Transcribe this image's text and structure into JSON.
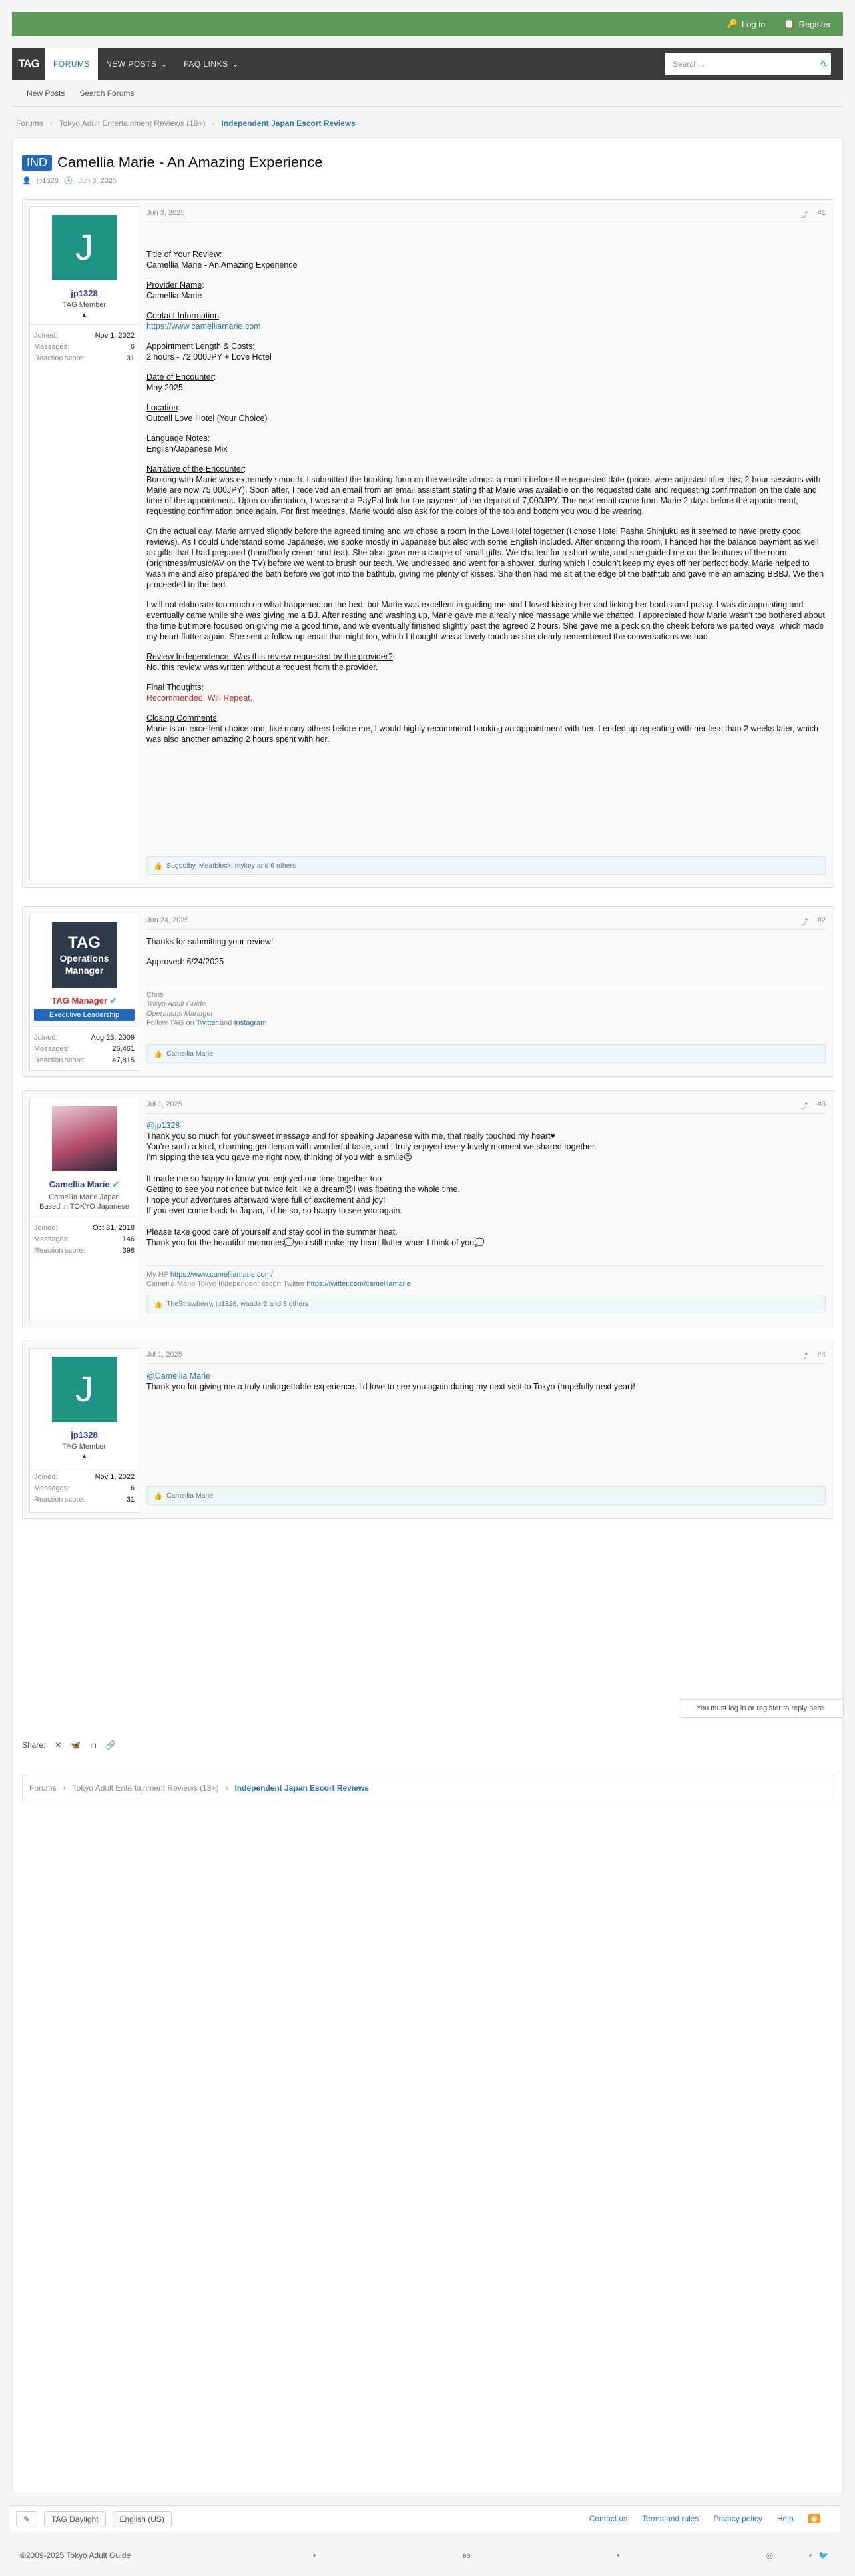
{
  "colors": {
    "accent": "#5d9a57",
    "nav": "#3b3b3b",
    "link": "#2577b1",
    "badge": "#2567b8",
    "username": "#2b3e9e"
  },
  "topbar": {
    "login": "Log in",
    "register": "Register"
  },
  "nav": {
    "logo": "TAG",
    "forums": "FORUMS",
    "new_posts": "NEW POSTS",
    "faq_links": "FAQ LINKS",
    "search_placeholder": "Search..."
  },
  "subnav": {
    "new_posts": "New Posts",
    "search_forums": "Search Forums"
  },
  "breadcrumb": {
    "forums": "Forums",
    "reviews": "Tokyo Adult Entertainment Reviews (18+)",
    "current": "Independent Japan Escort Reviews"
  },
  "thread": {
    "prefix": "IND",
    "title": "Camellia Marie - An Amazing Experience",
    "author": "jp1328",
    "date": "Jun 3, 2025"
  },
  "posts": [
    {
      "user": {
        "avatar_letter": "J",
        "name": "jp1328",
        "title": "TAG Member",
        "joined": "Nov 1, 2022",
        "messages": "6",
        "reaction": "31"
      },
      "date": "Jun 3, 2025",
      "num": "#1",
      "fields": [
        {
          "label": "Title of Your Review",
          "value": "Camellia Marie - An Amazing Experience"
        },
        {
          "label": "Provider Name",
          "value": "Camellia Marie"
        },
        {
          "label": "Contact Information",
          "value": "https://www.camelliamarie.com"
        },
        {
          "label": "Appointment Length & Costs",
          "value": "2 hours - 72,000JPY + Love Hotel"
        },
        {
          "label": "Date of Encounter",
          "value": "May 2025"
        },
        {
          "label": "Location",
          "value": "Outcall Love Hotel (Your Choice)"
        },
        {
          "label": "Language Notes",
          "value": "English/Japanese Mix"
        }
      ],
      "narrative_label": "Narrative of the Encounter",
      "narrative": [
        "Booking with Marie was extremely smooth. I submitted the booking form on the website almost a month before the requested date (prices were adjusted after this; 2-hour sessions with Marie are now 75,000JPY). Soon after, I received an email from an email assistant stating that Marie was available on the requested date and requesting confirmation on the date and time of the appointment. Upon confirmation, I was sent a PayPal link for the payment of the deposit of 7,000JPY. The next email came from Marie 2 days before the appointment, requesting confirmation once again. For first meetings, Marie would also ask for the colors of the top and bottom you would be wearing.",
        "On the actual day, Marie arrived slightly before the agreed timing and we chose a room in the Love Hotel together (I chose Hotel Pasha Shinjuku as it seemed to have pretty good reviews). As I could understand some Japanese, we spoke mostly in Japanese but also with some English included. After entering the room, I handed her the balance payment as well as gifts that I had prepared (hand/body cream and tea). She also gave me a couple of small gifts. We chatted for a short while, and she guided me on the features of the room (brightness/music/AV on the TV) before we went to brush our teeth. We undressed and went for a shower, during which I couldn't keep my eyes off her perfect body. Marie helped to wash me and also prepared the bath before we got into the bathtub, giving me plenty of kisses. She then had me sit at the edge of the bathtub and gave me an amazing BBBJ. We then proceeded to the bed.",
        "I will not elaborate too much on what happened on the bed, but Marie was excellent in guiding me and I loved kissing her and licking her boobs and pussy. I was disappointing and eventually came while she was giving me a BJ. After resting and washing up, Marie gave me a really nice massage while we chatted. I appreciated how Marie wasn't too bothered about the time but more focused on giving me a good time, and we eventually finished slightly past the agreed 2 hours. She gave me a peck on the cheek before we parted ways, which made my heart flutter again. She sent a follow-up email that night too, which I thought was a lovely touch as she clearly remembered the conversations we had."
      ],
      "independence_label": "Review Independence: Was this review requested by the provider?",
      "independence": "No, this review was written without a request from the provider.",
      "final_label": "Final Thoughts",
      "final": "Recommended, Will Repeat.",
      "closing_label": "Closing Comments",
      "closing": "Marie is an excellent choice and, like many others before me, I would highly recommend booking an appointment with her. I ended up repeating with her less than 2 weeks later, which was also another amazing 2 hours spent with her.",
      "reactions": "Sugodiby, Meatblock, mykey and 6 others"
    },
    {
      "user": {
        "avatar_line1": "TAG",
        "avatar_line2": "Operations",
        "avatar_line3": "Manager",
        "name": "TAG Manager",
        "banner": "Executive Leadership",
        "joined": "Aug 23, 2009",
        "messages": "26,461",
        "reaction": "47,815"
      },
      "date": "Jun 24, 2025",
      "num": "#2",
      "text1": "Thanks for submitting your review!",
      "text2": "Approved: 6/24/2025",
      "sig": {
        "name": "Chris",
        "org": "Tokyo Adult Guide",
        "role": "Operations Manager",
        "follow": "Follow TAG on",
        "twitter": "Twitter",
        "and": "and",
        "instagram": "Instagram"
      },
      "reactions": "Camellia Marie"
    },
    {
      "user": {
        "name": "Camellia Marie",
        "title": "Camellia Marie Japan Based in TOKYO Japanese",
        "joined": "Oct 31, 2018",
        "messages": "146",
        "reaction": "398"
      },
      "date": "Jul 1, 2025",
      "num": "#3",
      "mention": "@jp1328",
      "lines": [
        "Thank you so much for your sweet message  and for speaking Japanese with me, that really touched my heart♥",
        "You're such a kind, charming gentleman with wonderful taste, and I truly enjoyed every lovely moment we shared together.",
        "I'm sipping the tea you gave me right now, thinking of you with a smile😊",
        "",
        "It made me so happy to know you enjoyed our time together too",
        "Getting to see you not once but twice felt like a dream😊I was floating the whole time.",
        "I hope your adventures afterward were full of excitement and joy!",
        "If you ever come back to Japan, I'd be so, so happy to see you again.",
        "",
        "Please take good care of yourself and stay cool in the summer heat.",
        "Thank you for the beautiful memories💭you still make my heart flutter when I think of you💭"
      ],
      "sig_hp_label": "My HP",
      "sig_hp": "https://www.camelliamarie.com/",
      "sig_tw_label": "Camellia Marie Tokyo Independent escort Twitter",
      "sig_tw": "https://twitter.com/camelliamarie",
      "reactions": "TheStrawberry, jp1328, waader2 and 3 others"
    },
    {
      "user": {
        "avatar_letter": "J",
        "name": "jp1328",
        "title": "TAG Member",
        "joined": "Nov 1, 2022",
        "messages": "6",
        "reaction": "31"
      },
      "date": "Jul 1, 2025",
      "num": "#4",
      "mention": "@Camellia Marie",
      "text": "Thank you for giving me a truly unforgettable experience. I'd love to see you again during my next visit to Tokyo (hopefully next year)!",
      "reactions": "Camellia Marie"
    }
  ],
  "labels": {
    "joined": "Joined:",
    "messages": "Messages:",
    "reaction": "Reaction score:"
  },
  "reply_notice": "You must log in or register to reply here.",
  "share_label": "Share:",
  "footer": {
    "style": "TAG Daylight",
    "lang": "English (US)",
    "contact": "Contact us",
    "terms": "Terms and rules",
    "privacy": "Privacy policy",
    "help": "Help",
    "copyright": "©2009-2025 Tokyo Adult Guide"
  }
}
